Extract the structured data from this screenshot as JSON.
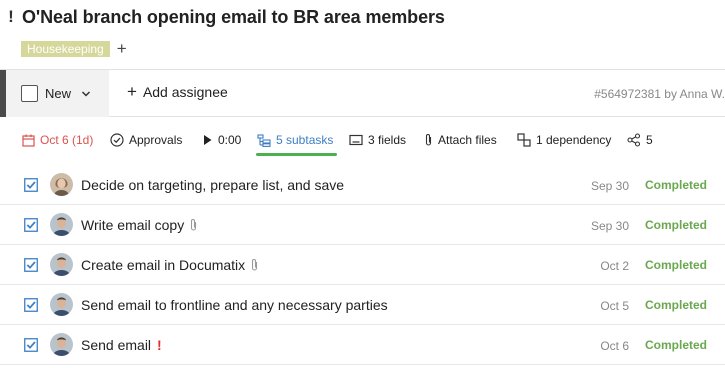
{
  "header": {
    "priority_marker": "!",
    "title": "O'Neal branch opening email to BR area members"
  },
  "tags": {
    "items": [
      "Housekeeping"
    ],
    "add_label": "+"
  },
  "toolbar": {
    "status_label": "New",
    "add_assignee_label": "Add assignee",
    "task_id_text": "#564972381 by Anna W."
  },
  "meta": {
    "due": "Oct 6 (1d)",
    "approvals": "Approvals",
    "timer": "0:00",
    "subtasks": "5 subtasks",
    "fields": "3 fields",
    "attach": "Attach files",
    "dependency": "1 dependency",
    "share_count": "5"
  },
  "colors": {
    "due": "#d9534f",
    "subtasks_link": "#3d7fc4",
    "active_underline": "#4cb050",
    "completed": "#6aa84f",
    "tag_bg": "#d6d79a",
    "checkbox": "#3d7fc4",
    "urgent": "#e03030"
  },
  "subtasks": [
    {
      "name": "Decide on targeting, prepare list, and save",
      "date": "Sep 30",
      "status": "Completed",
      "has_attachment": false,
      "urgent": false,
      "avatar": "woman"
    },
    {
      "name": "Write email copy",
      "date": "Sep 30",
      "status": "Completed",
      "has_attachment": true,
      "urgent": false,
      "avatar": "man"
    },
    {
      "name": "Create email in Documatix",
      "date": "Oct 2",
      "status": "Completed",
      "has_attachment": true,
      "urgent": false,
      "avatar": "man"
    },
    {
      "name": "Send email to frontline and any necessary parties",
      "date": "Oct 5",
      "status": "Completed",
      "has_attachment": false,
      "urgent": false,
      "avatar": "man"
    },
    {
      "name": "Send email",
      "date": "Oct 6",
      "status": "Completed",
      "has_attachment": false,
      "urgent": true,
      "urgent_mark": "!",
      "avatar": "man"
    }
  ]
}
